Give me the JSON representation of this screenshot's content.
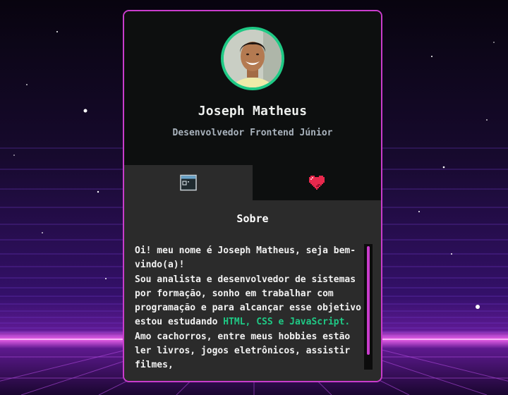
{
  "profile": {
    "name": "Joseph Matheus",
    "role": "Desenvolvedor Frontend Júnior",
    "avatar_alt": "Joseph Matheus"
  },
  "tabs": [
    {
      "id": "about",
      "icon": "browser-window-icon",
      "active": true
    },
    {
      "id": "favorites",
      "icon": "heart-icon",
      "active": false
    }
  ],
  "about": {
    "title": "Sobre",
    "greeting": "Oi! meu nome é Joseph Matheus, seja bem-vindo(a)!",
    "intro": "Sou analista e desenvolvedor de sistemas por formação, sonho em trabalhar com programação e para alcançar esse objetivo estou estudando",
    "technologies": "HTML, CSS e JavaScript.",
    "hobbies": " Amo cachorros, entre meus hobbies estão ler livros, jogos eletrônicos, assistir filmes,"
  },
  "colors": {
    "accent_border": "#c93ccc",
    "avatar_ring": "#1fc985",
    "highlight": "#1fc985",
    "heart": "#e8294d"
  }
}
